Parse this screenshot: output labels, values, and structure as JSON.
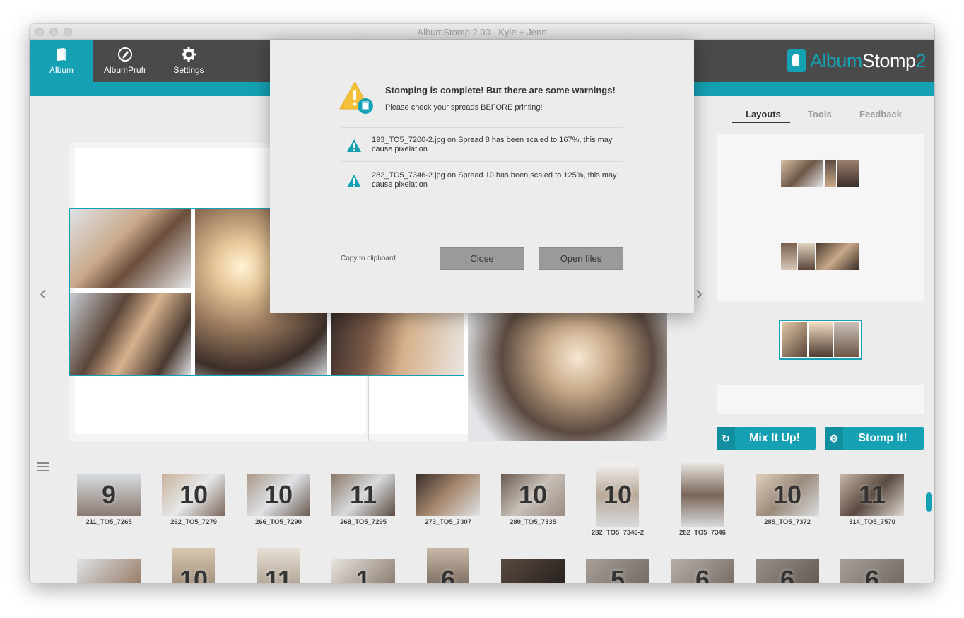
{
  "window": {
    "title": "AlbumStomp 2.00 - Kyle + Jenn"
  },
  "toolbar": {
    "buttons": [
      {
        "label": "Album",
        "icon": "album-icon"
      },
      {
        "label": "AlbumPrufr",
        "icon": "prufr-icon"
      },
      {
        "label": "Settings",
        "icon": "gear-icon"
      }
    ],
    "logo": {
      "part1": "Album",
      "part2": "Stomp",
      "part3": "2"
    }
  },
  "right_panel": {
    "tabs": [
      "Layouts",
      "Tools",
      "Feedback"
    ],
    "active_tab": "Layouts",
    "mix_label": "Mix It Up!",
    "stomp_label": "Stomp It!"
  },
  "dialog": {
    "title": "Stomping is complete! But there are some warnings!",
    "subtitle": "Please check your spreads BEFORE printing!",
    "warnings": [
      "193_TO5_7200-2.jpg on Spread 8 has been scaled to 167%, this may cause pixelation",
      "282_TO5_7346-2.jpg on Spread 10 has been scaled to 125%, this may cause pixelation"
    ],
    "copy_label": "Copy to clipboard",
    "close_label": "Close",
    "open_label": "Open files"
  },
  "thumbnails_row1": [
    {
      "num": "9",
      "name": "211_TO5_7265"
    },
    {
      "num": "10",
      "name": "262_TO5_7279"
    },
    {
      "num": "10",
      "name": "266_TO5_7290"
    },
    {
      "num": "11",
      "name": "268_TO5_7295"
    },
    {
      "num": "",
      "name": "273_TO5_7307"
    },
    {
      "num": "10",
      "name": "280_TO5_7335"
    },
    {
      "num": "10",
      "name": "282_TO5_7346-2"
    },
    {
      "num": "",
      "name": "282_TO5_7346"
    },
    {
      "num": "10",
      "name": "285_TO5_7372"
    },
    {
      "num": "11",
      "name": "314_TO5_7570"
    }
  ],
  "thumbnails_row2": [
    {
      "num": ""
    },
    {
      "num": "10"
    },
    {
      "num": "11"
    },
    {
      "num": "1"
    },
    {
      "num": "6"
    },
    {
      "num": ""
    },
    {
      "num": "5"
    },
    {
      "num": "6"
    },
    {
      "num": "6"
    },
    {
      "num": "6"
    }
  ],
  "colors": {
    "accent": "#15a1b3",
    "toolbar": "#4a4a4a",
    "background": "#ececec"
  }
}
